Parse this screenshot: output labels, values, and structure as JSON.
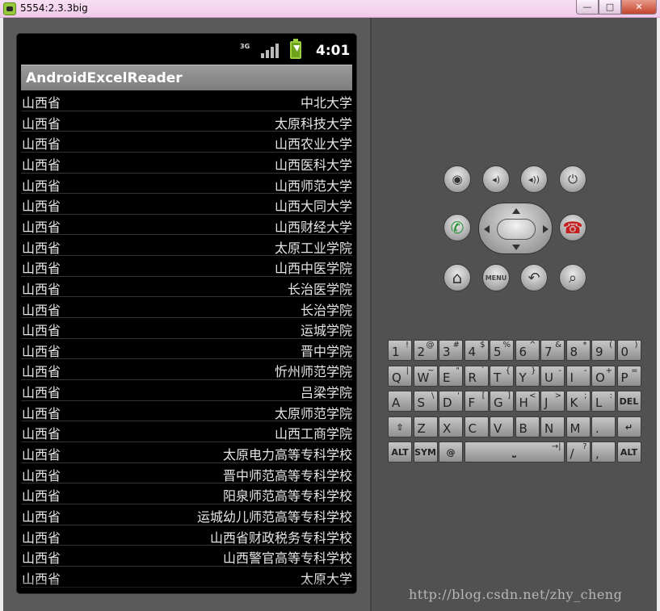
{
  "window": {
    "title": "5554:2.3.3big",
    "minimize_glyph": "—",
    "maximize_glyph": "□",
    "close_glyph": "✕"
  },
  "status_bar": {
    "network_label": "3G",
    "time": "4:01"
  },
  "app_bar": {
    "title": "AndroidExcelReader"
  },
  "list": {
    "rows": [
      {
        "province": "山西省",
        "university": "中北大学"
      },
      {
        "province": "山西省",
        "university": "太原科技大学"
      },
      {
        "province": "山西省",
        "university": "山西农业大学"
      },
      {
        "province": "山西省",
        "university": "山西医科大学"
      },
      {
        "province": "山西省",
        "university": "山西师范大学"
      },
      {
        "province": "山西省",
        "university": "山西大同大学"
      },
      {
        "province": "山西省",
        "university": "山西财经大学"
      },
      {
        "province": "山西省",
        "university": "太原工业学院"
      },
      {
        "province": "山西省",
        "university": "山西中医学院"
      },
      {
        "province": "山西省",
        "university": "长治医学院"
      },
      {
        "province": "山西省",
        "university": "长治学院"
      },
      {
        "province": "山西省",
        "university": "运城学院"
      },
      {
        "province": "山西省",
        "university": "晋中学院"
      },
      {
        "province": "山西省",
        "university": "忻州师范学院"
      },
      {
        "province": "山西省",
        "university": "吕梁学院"
      },
      {
        "province": "山西省",
        "university": "太原师范学院"
      },
      {
        "province": "山西省",
        "university": "山西工商学院"
      },
      {
        "province": "山西省",
        "university": "太原电力高等专科学校"
      },
      {
        "province": "山西省",
        "university": "晋中师范高等专科学校"
      },
      {
        "province": "山西省",
        "university": "阳泉师范高等专科学校"
      },
      {
        "province": "山西省",
        "university": "运城幼儿师范高等专科学校"
      },
      {
        "province": "山西省",
        "university": "山西省财政税务专科学校"
      },
      {
        "province": "山西省",
        "university": "山西警官高等专科学校"
      },
      {
        "province": "山西省",
        "university": "太原大学"
      }
    ]
  },
  "hardware": {
    "menu_label": "MENU",
    "camera_glyph": "◉",
    "volume_down_glyph": "◂)",
    "volume_up_glyph": "◂))",
    "power_glyph": "⏻",
    "call_glyph": "✆",
    "endcall_glyph": "☎",
    "home_glyph": "⌂",
    "back_glyph": "↶",
    "search_glyph": "⌕"
  },
  "keyboard": {
    "row1": [
      {
        "k": "1",
        "s": "!"
      },
      {
        "k": "2",
        "s": "@"
      },
      {
        "k": "3",
        "s": "#"
      },
      {
        "k": "4",
        "s": "$"
      },
      {
        "k": "5",
        "s": "%"
      },
      {
        "k": "6",
        "s": "^"
      },
      {
        "k": "7",
        "s": "&"
      },
      {
        "k": "8",
        "s": "*"
      },
      {
        "k": "9",
        "s": "("
      },
      {
        "k": "0",
        "s": ")"
      }
    ],
    "row2": [
      {
        "k": "Q",
        "s": "|"
      },
      {
        "k": "W",
        "s": "~"
      },
      {
        "k": "E",
        "s": "\""
      },
      {
        "k": "R",
        "s": "`"
      },
      {
        "k": "T",
        "s": "{"
      },
      {
        "k": "Y",
        "s": "}"
      },
      {
        "k": "U",
        "s": "-"
      },
      {
        "k": "I",
        "s": "-"
      },
      {
        "k": "O",
        "s": "+"
      },
      {
        "k": "P",
        "s": "="
      }
    ],
    "row3": [
      {
        "k": "A",
        "s": ""
      },
      {
        "k": "S",
        "s": "\\"
      },
      {
        "k": "D",
        "s": "'"
      },
      {
        "k": "F",
        "s": "["
      },
      {
        "k": "G",
        "s": "]"
      },
      {
        "k": "H",
        "s": "<"
      },
      {
        "k": "J",
        "s": ">"
      },
      {
        "k": "K",
        "s": ";"
      },
      {
        "k": "L",
        "s": ":"
      }
    ],
    "del_label": "DEL",
    "row4": [
      {
        "k": "Z",
        "s": ""
      },
      {
        "k": "X",
        "s": ""
      },
      {
        "k": "C",
        "s": ""
      },
      {
        "k": "V",
        "s": ""
      },
      {
        "k": "B",
        "s": ""
      },
      {
        "k": "N",
        "s": ""
      },
      {
        "k": "M",
        "s": ""
      },
      {
        "k": ".",
        "s": ""
      }
    ],
    "shift_glyph": "⇧",
    "enter_glyph": "↵",
    "alt_label": "ALT",
    "sym_label": "SYM",
    "at_label": "@",
    "space_glyph": "⎵",
    "tab_glyph": "→|",
    "slash_label": "/",
    "question_label": "?",
    "comma_label": ","
  },
  "watermark": "http://blog.csdn.net/zhy_cheng"
}
